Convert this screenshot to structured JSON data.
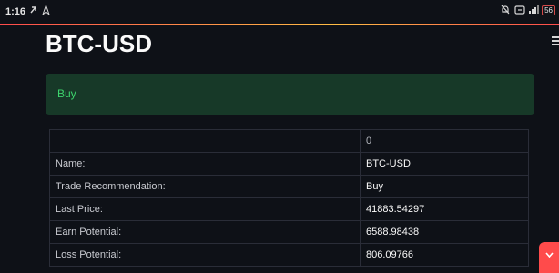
{
  "status_bar": {
    "time": "1:16",
    "battery": "56"
  },
  "page": {
    "title": "BTC-USD"
  },
  "alert": {
    "text": "Buy",
    "color": "#3dd56d",
    "background": "#173928"
  },
  "table": {
    "column_header": "0",
    "rows": [
      {
        "label": "Name:",
        "value": "BTC-USD"
      },
      {
        "label": "Trade Recommendation:",
        "value": "Buy"
      },
      {
        "label": "Last Price:",
        "value": "41883.54297"
      },
      {
        "label": "Earn Potential:",
        "value": "6588.98438"
      },
      {
        "label": "Loss Potential:",
        "value": "806.09766"
      }
    ]
  },
  "icons": {
    "status_left": [
      "link-icon",
      "navigation-icon"
    ],
    "status_right": [
      "mute-icon",
      "wifi-icon",
      "signal-icon",
      "battery-icon"
    ],
    "menu": "hamburger-menu-icon",
    "fab": "chevron-down-icon"
  },
  "colors": {
    "background": "#0e1117",
    "accent": "#ff4b4b"
  }
}
